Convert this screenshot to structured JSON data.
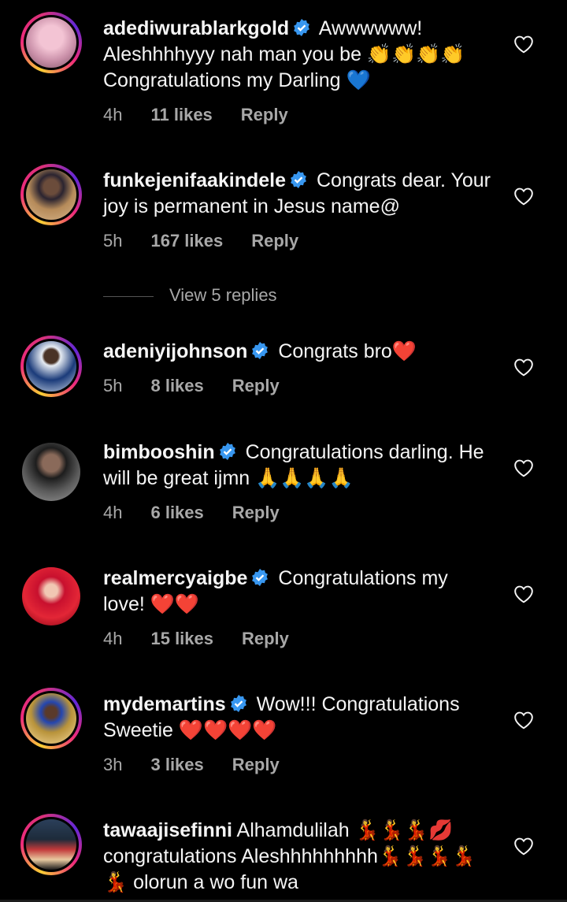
{
  "comments": [
    {
      "username": "adediwurablarkgold",
      "text": "Awwwwww! Aleshhhhyyy nah man you be 👏👏👏👏 Congratulations my Darling 💙",
      "time": "4h",
      "likes": "11 likes",
      "reply": "Reply",
      "verified": true,
      "avatar_colors": [
        "#e9b7c9",
        "#c98fa8"
      ]
    },
    {
      "username": "funkejenifaakindele",
      "text": "Congrats dear. Your joy is permanent in Jesus name@",
      "time": "5h",
      "likes": "167 likes",
      "reply": "Reply",
      "verified": true,
      "avatar_colors": [
        "#b68b5a",
        "#3c3142"
      ]
    },
    {
      "username": "adeniyijohnson",
      "text": "Congrats bro❤️",
      "time": "5h",
      "likes": "8 likes",
      "reply": "Reply",
      "verified": true,
      "avatar_colors": [
        "#1b3b7a",
        "#dfe7f0"
      ]
    },
    {
      "username": "bimbooshin",
      "text": "Congratulations darling. He will be great ijmn 🙏🙏🙏🙏",
      "time": "4h",
      "likes": "6 likes",
      "reply": "Reply",
      "verified": true,
      "avatar_colors": [
        "#2a2a2a",
        "#8a6a5a"
      ]
    },
    {
      "username": "realmercyaigbe",
      "text": "Congratulations my love! ❤️❤️",
      "time": "4h",
      "likes": "15 likes",
      "reply": "Reply",
      "verified": true,
      "avatar_colors": [
        "#d9132a",
        "#f4d0d0"
      ]
    },
    {
      "username": "mydemartins",
      "text": "Wow!!! Congratulations Sweetie ❤️❤️❤️❤️",
      "time": "3h",
      "likes": "3 likes",
      "reply": "Reply",
      "verified": true,
      "avatar_colors": [
        "#1f3fa0",
        "#b8933a"
      ]
    },
    {
      "username": "tawaajisefinni",
      "text": "Alhamdulilah 💃💃💃💋 congratulations Aleshhhhhhhhh💃💃💃💃💃 olorun a wo fun wa",
      "time": "",
      "likes": "",
      "reply": "",
      "verified": false,
      "avatar_colors": [
        "#1d2b3a",
        "#c23a3a"
      ]
    }
  ],
  "view_replies": "View 5 replies",
  "colors": {
    "background": "#000000",
    "text": "#f5f5f5",
    "muted": "#a8a8a8",
    "verified": "#3897f0"
  }
}
